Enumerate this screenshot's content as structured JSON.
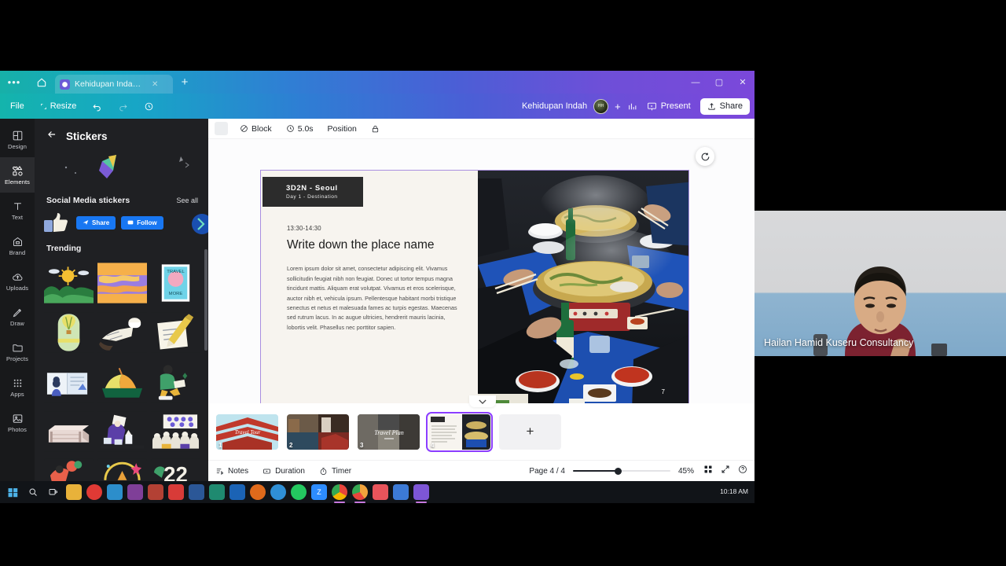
{
  "window": {
    "tab": {
      "title": "Kehidupan Indah - ...",
      "favicon_icon": "canva-icon",
      "close_icon": "close-icon",
      "new_tab_icon": "plus-icon"
    },
    "home_icon": "home-icon",
    "overflow_icon": "more-horizontal-icon",
    "controls": {
      "minimize": "minimize-icon",
      "maximize": "maximize-icon",
      "close": "close-icon"
    }
  },
  "toolbar": {
    "file_label": "File",
    "resize_label": "Resize",
    "undo_icon": "undo-icon",
    "redo_icon": "redo-icon",
    "cloud_icon": "cloud-sync-icon",
    "doc_name": "Kehidupan Indah",
    "avatar_initials": "HH",
    "add_member_icon": "plus-icon",
    "insights_icon": "insights-chart-icon",
    "present_label": "Present",
    "present_icon": "present-icon",
    "share_label": "Share",
    "share_icon": "share-upload-icon"
  },
  "rail": {
    "items": [
      {
        "label": "Design",
        "icon": "design-icon",
        "active": false
      },
      {
        "label": "Elements",
        "icon": "elements-icon",
        "active": true
      },
      {
        "label": "Text",
        "icon": "text-icon",
        "active": false
      },
      {
        "label": "Brand",
        "icon": "brand-icon",
        "active": false
      },
      {
        "label": "Uploads",
        "icon": "uploads-icon",
        "active": false
      },
      {
        "label": "Draw",
        "icon": "draw-icon",
        "active": false
      },
      {
        "label": "Projects",
        "icon": "projects-icon",
        "active": false
      },
      {
        "label": "Apps",
        "icon": "apps-icon",
        "active": false
      },
      {
        "label": "Photos",
        "icon": "photos-icon",
        "active": false
      }
    ]
  },
  "panel": {
    "back_icon": "back-arrow-icon",
    "title": "Stickers",
    "social_section": {
      "title": "Social Media stickers",
      "see_all": "See all"
    },
    "social_chips": [
      {
        "label": "Share",
        "icon": "share-arrow-icon"
      },
      {
        "label": "Follow",
        "icon": "follow-icon"
      }
    ],
    "trending_title": "Trending"
  },
  "context_bar": {
    "block_label": "Block",
    "block_icon": "block-icon",
    "duration_label": "5.0s",
    "duration_icon": "clock-icon",
    "position_label": "Position",
    "lock_icon": "lock-icon"
  },
  "slide": {
    "badge_title": "3D2N - Seoul",
    "badge_subtitle": "Day 1 - Destination",
    "time": "13:30-14:30",
    "heading": "Write down the place name",
    "body": "Lorem ipsum dolor sit amet, consectetur adipiscing elit. Vivamus sollicitudin feugiat nibh non feugiat. Donec ut tortor tempus magna tincidunt mattis. Aliquam erat volutpat. Vivamus et eros scelerisque, auctor nibh et, vehicula ipsum. Pellentesque habitant morbi tristique senectus et netus et malesuada fames ac turpis egestas. Maecenas sed rutrum lacus. In ac augue ultricies, hendrerit mauris lacinia, lobortis velit. Phasellus nec porttitor sapien.",
    "photo_number": "7",
    "animate_icon": "animate-icon",
    "magic_icon": "magic-studio-sparkle-icon"
  },
  "pages": {
    "thumbs": [
      {
        "number": "1"
      },
      {
        "number": "2"
      },
      {
        "number": "3"
      },
      {
        "number": "4",
        "selected": true
      }
    ],
    "add_label": "+",
    "collapse_icon": "chevron-down-icon"
  },
  "bottom_bar": {
    "notes_label": "Notes",
    "notes_icon": "notes-icon",
    "duration_label": "Duration",
    "duration_icon": "duration-icon",
    "timer_label": "Timer",
    "timer_icon": "timer-icon",
    "page_indicator": "Page 4 / 4",
    "zoom_percent": "45%",
    "grid_icon": "grid-view-icon",
    "fullscreen_icon": "fullscreen-icon",
    "help_icon": "help-icon"
  },
  "video": {
    "participant_name": "Hailan Hamid Kuseru Consultancy"
  },
  "taskbar": {
    "start_icon": "windows-start-icon",
    "search_icon": "search-icon",
    "taskview_icon": "task-view-icon",
    "clock": "10:18 AM",
    "apps": [
      {
        "name": "file-explorer-icon",
        "color": "#e8b23a",
        "running": false
      },
      {
        "name": "opera-icon",
        "color": "#e03a35",
        "running": false
      },
      {
        "name": "edge-icon",
        "color": "#2c8ecb",
        "running": false
      },
      {
        "name": "onenote-icon",
        "color": "#7f3f98",
        "running": false
      },
      {
        "name": "excel-icon",
        "color": "#b34134",
        "running": false
      },
      {
        "name": "pdf-icon",
        "color": "#d83b38",
        "running": false
      },
      {
        "name": "word-icon",
        "color": "#2b5797",
        "running": false
      },
      {
        "name": "teams-icon",
        "color": "#1f8a70",
        "running": false
      },
      {
        "name": "outlook-icon",
        "color": "#1b63b5",
        "running": false
      },
      {
        "name": "firefox-icon",
        "color": "#e06a1b",
        "running": false
      },
      {
        "name": "telegram-icon",
        "color": "#2f8fd6",
        "running": false
      },
      {
        "name": "whatsapp-icon",
        "color": "#24c860",
        "running": false
      },
      {
        "name": "zoom-icon",
        "color": "#2d8cff",
        "running": false
      },
      {
        "name": "chrome-icon",
        "color": "#34a853",
        "running": true
      },
      {
        "name": "chrome-window-icon",
        "color": "#f2a33c",
        "running": true
      },
      {
        "name": "photos-icon",
        "color": "#e8545b",
        "running": false
      },
      {
        "name": "store-icon",
        "color": "#3c7ad6",
        "running": false
      },
      {
        "name": "canva-icon",
        "color": "#7d56d6",
        "running": true
      }
    ]
  },
  "colors": {
    "canva_purple": "#8b3dff",
    "header_teal": "#14b4ac",
    "header_violet": "#7c47db",
    "slide_bg": "#f7f4ef",
    "badge_dark": "#2c2c2c"
  }
}
